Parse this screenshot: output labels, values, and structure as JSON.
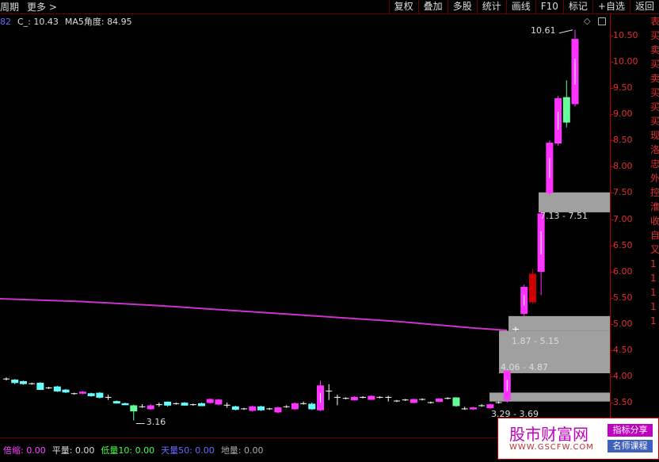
{
  "toolbar": {
    "left_items": [
      "周期",
      "更多 >"
    ],
    "right_buttons": [
      "复权",
      "叠加",
      "多股",
      "统计",
      "画线",
      "F10",
      "标记",
      "+自选",
      "返回"
    ]
  },
  "indicator": {
    "selected": "82",
    "close_label": "C_: 10.43",
    "ma5_angle_label": "MA5角度: 84.95"
  },
  "price_axis": {
    "ticks": [
      "10.50",
      "10.00",
      "9.50",
      "9.00",
      "8.50",
      "8.00",
      "7.50",
      "7.00",
      "6.50",
      "6.00",
      "5.50",
      "5.00",
      "4.50",
      "4.00",
      "3.50"
    ],
    "values": [
      10.5,
      10,
      9.5,
      9,
      8.5,
      8,
      7.5,
      7,
      6.5,
      6,
      5.5,
      5,
      4.5,
      4,
      3.5
    ]
  },
  "right_edge_chars": [
    "表",
    "买",
    "卖",
    "买",
    "卖",
    "买",
    "买",
    "买",
    "现",
    "洛",
    "忠",
    "外",
    "控",
    "淮",
    "收",
    "自",
    "又",
    "1",
    "1",
    "1",
    "1",
    "1"
  ],
  "annotations": {
    "high": "10.61",
    "low": "3.16",
    "zone1": "7.13 - 7.51",
    "zone2": "1.87 - 5.15",
    "zone3": "4.06 - 4.87",
    "zone4": "3.29 - 3.69"
  },
  "bottom_bar": {
    "item1": "倍缩: 0.00",
    "item2": "平量: 0.00",
    "item3": "低量10: 0.00",
    "item4": "天量50: 0.00",
    "item5": "地量: 0.00"
  },
  "watermark": {
    "main": "股市财富网",
    "url": "WWW.GSCFW.COM",
    "tag1": "指标分享",
    "tag2": "名师课程"
  },
  "colors": {
    "up": "#ff33ff",
    "down": "#66ffff",
    "green": "#66ff99",
    "red_body": "#cc0000",
    "ma_line": "#cc33cc",
    "zone": "#a0a0a0"
  },
  "chart_data": {
    "type": "candlestick",
    "ylim": [
      3.3,
      10.75
    ],
    "candles": [
      {
        "o": 3.95,
        "c": 3.95,
        "h": 3.98,
        "l": 3.92,
        "t": "flat"
      },
      {
        "o": 3.93,
        "c": 3.88,
        "h": 3.95,
        "l": 3.85,
        "t": "down"
      },
      {
        "o": 3.9,
        "c": 3.86,
        "h": 3.92,
        "l": 3.84,
        "t": "down"
      },
      {
        "o": 3.86,
        "c": 3.86,
        "h": 3.88,
        "l": 3.84,
        "t": "flat"
      },
      {
        "o": 3.87,
        "c": 3.75,
        "h": 3.89,
        "l": 3.74,
        "t": "down"
      },
      {
        "o": 3.78,
        "c": 3.78,
        "h": 3.8,
        "l": 3.76,
        "t": "flat"
      },
      {
        "o": 3.8,
        "c": 3.72,
        "h": 3.82,
        "l": 3.7,
        "t": "down"
      },
      {
        "o": 3.74,
        "c": 3.7,
        "h": 3.76,
        "l": 3.68,
        "t": "down"
      },
      {
        "o": 3.67,
        "c": 3.67,
        "h": 3.69,
        "l": 3.65,
        "t": "flat"
      },
      {
        "o": 3.7,
        "c": 3.68,
        "h": 3.72,
        "l": 3.66,
        "t": "up"
      },
      {
        "o": 3.67,
        "c": 3.63,
        "h": 3.69,
        "l": 3.61,
        "t": "down"
      },
      {
        "o": 3.68,
        "c": 3.6,
        "h": 3.7,
        "l": 3.58,
        "t": "down"
      },
      {
        "o": 3.6,
        "c": 3.6,
        "h": 3.65,
        "l": 3.55,
        "t": "flat"
      },
      {
        "o": 3.52,
        "c": 3.49,
        "h": 3.54,
        "l": 3.48,
        "t": "down"
      },
      {
        "o": 3.48,
        "c": 3.46,
        "h": 3.5,
        "l": 3.45,
        "t": "down"
      },
      {
        "o": 3.44,
        "c": 3.34,
        "h": 3.46,
        "l": 3.16,
        "t": "green"
      },
      {
        "o": 3.42,
        "c": 3.42,
        "h": 3.47,
        "l": 3.4,
        "t": "flat"
      },
      {
        "o": 3.38,
        "c": 3.44,
        "h": 3.47,
        "l": 3.36,
        "t": "up"
      },
      {
        "o": 3.46,
        "c": 3.46,
        "h": 3.5,
        "l": 3.42,
        "t": "flat"
      },
      {
        "o": 3.51,
        "c": 3.45,
        "h": 3.52,
        "l": 3.42,
        "t": "down"
      },
      {
        "o": 3.48,
        "c": 3.48,
        "h": 3.5,
        "l": 3.46,
        "t": "flat"
      },
      {
        "o": 3.49,
        "c": 3.45,
        "h": 3.51,
        "l": 3.44,
        "t": "down"
      },
      {
        "o": 3.46,
        "c": 3.46,
        "h": 3.48,
        "l": 3.44,
        "t": "flat"
      },
      {
        "o": 3.48,
        "c": 3.44,
        "h": 3.5,
        "l": 3.43,
        "t": "down"
      },
      {
        "o": 3.5,
        "c": 3.56,
        "h": 3.58,
        "l": 3.48,
        "t": "up"
      },
      {
        "o": 3.55,
        "c": 3.47,
        "h": 3.57,
        "l": 3.45,
        "t": "up"
      },
      {
        "o": 3.45,
        "c": 3.45,
        "h": 3.5,
        "l": 3.4,
        "t": "flat"
      },
      {
        "o": 3.42,
        "c": 3.37,
        "h": 3.44,
        "l": 3.35,
        "t": "down"
      },
      {
        "o": 3.38,
        "c": 3.38,
        "h": 3.4,
        "l": 3.36,
        "t": "flat"
      },
      {
        "o": 3.35,
        "c": 3.42,
        "h": 3.44,
        "l": 3.33,
        "t": "up"
      },
      {
        "o": 3.42,
        "c": 3.36,
        "h": 3.44,
        "l": 3.34,
        "t": "down"
      },
      {
        "o": 3.38,
        "c": 3.38,
        "h": 3.4,
        "l": 3.36,
        "t": "flat"
      },
      {
        "o": 3.32,
        "c": 3.4,
        "h": 3.42,
        "l": 3.3,
        "t": "up"
      },
      {
        "o": 3.42,
        "c": 3.42,
        "h": 3.45,
        "l": 3.4,
        "t": "flat"
      },
      {
        "o": 3.38,
        "c": 3.48,
        "h": 3.5,
        "l": 3.36,
        "t": "up"
      },
      {
        "o": 3.48,
        "c": 3.48,
        "h": 3.52,
        "l": 3.46,
        "t": "flat"
      },
      {
        "o": 3.47,
        "c": 3.38,
        "h": 3.5,
        "l": 3.36,
        "t": "down"
      },
      {
        "o": 3.36,
        "c": 3.82,
        "h": 3.92,
        "l": 3.34,
        "t": "up"
      },
      {
        "o": 3.72,
        "c": 3.72,
        "h": 3.85,
        "l": 3.55,
        "t": "flat"
      },
      {
        "o": 3.6,
        "c": 3.6,
        "h": 3.65,
        "l": 3.45,
        "t": "flat"
      },
      {
        "o": 3.58,
        "c": 3.58,
        "h": 3.6,
        "l": 3.56,
        "t": "flat"
      },
      {
        "o": 3.55,
        "c": 3.6,
        "h": 3.62,
        "l": 3.54,
        "t": "up"
      },
      {
        "o": 3.6,
        "c": 3.6,
        "h": 3.62,
        "l": 3.58,
        "t": "flat"
      },
      {
        "o": 3.56,
        "c": 3.62,
        "h": 3.64,
        "l": 3.55,
        "t": "up"
      },
      {
        "o": 3.6,
        "c": 3.6,
        "h": 3.62,
        "l": 3.58,
        "t": "flat"
      },
      {
        "o": 3.6,
        "c": 3.6,
        "h": 3.63,
        "l": 3.52,
        "t": "flat"
      },
      {
        "o": 3.53,
        "c": 3.53,
        "h": 3.55,
        "l": 3.51,
        "t": "flat"
      },
      {
        "o": 3.55,
        "c": 3.55,
        "h": 3.57,
        "l": 3.53,
        "t": "flat"
      },
      {
        "o": 3.5,
        "c": 3.56,
        "h": 3.57,
        "l": 3.49,
        "t": "up"
      },
      {
        "o": 3.56,
        "c": 3.56,
        "h": 3.58,
        "l": 3.54,
        "t": "flat"
      },
      {
        "o": 3.5,
        "c": 3.5,
        "h": 3.52,
        "l": 3.48,
        "t": "flat"
      },
      {
        "o": 3.52,
        "c": 3.57,
        "h": 3.58,
        "l": 3.51,
        "t": "up"
      },
      {
        "o": 3.58,
        "c": 3.58,
        "h": 3.6,
        "l": 3.56,
        "t": "flat"
      },
      {
        "o": 3.59,
        "c": 3.44,
        "h": 3.6,
        "l": 3.42,
        "t": "green"
      },
      {
        "o": 3.38,
        "c": 3.38,
        "h": 3.42,
        "l": 3.36,
        "t": "flat"
      },
      {
        "o": 3.38,
        "c": 3.4,
        "h": 3.42,
        "l": 3.36,
        "t": "up"
      },
      {
        "o": 3.44,
        "c": 3.44,
        "h": 3.47,
        "l": 3.42,
        "t": "flat"
      },
      {
        "o": 3.4,
        "c": 3.46,
        "h": 3.48,
        "l": 3.38,
        "t": "up"
      },
      {
        "o": 3.5,
        "c": 3.5,
        "h": 3.52,
        "l": 3.48,
        "t": "flat"
      },
      {
        "o": 3.55,
        "c": 4.1,
        "h": 4.1,
        "l": 3.5,
        "t": "up"
      },
      {
        "o": 4.9,
        "c": 4.9,
        "h": 4.95,
        "l": 4.86,
        "t": "flat"
      },
      {
        "o": 5.2,
        "c": 5.7,
        "h": 5.75,
        "l": 5.15,
        "t": "up"
      },
      {
        "o": 5.42,
        "c": 5.95,
        "h": 6.05,
        "l": 5.38,
        "t": "red"
      },
      {
        "o": 6.0,
        "c": 7.1,
        "h": 7.15,
        "l": 5.55,
        "t": "up"
      },
      {
        "o": 7.5,
        "c": 8.45,
        "h": 8.5,
        "l": 7.45,
        "t": "up"
      },
      {
        "o": 8.45,
        "c": 9.3,
        "h": 9.35,
        "l": 8.4,
        "t": "up"
      },
      {
        "o": 9.32,
        "c": 8.85,
        "h": 9.65,
        "l": 8.75,
        "t": "green"
      },
      {
        "o": 9.2,
        "c": 10.43,
        "h": 10.61,
        "l": 9.15,
        "t": "up"
      }
    ],
    "ma_line": [
      [
        0,
        5.48
      ],
      [
        100,
        5.43
      ],
      [
        200,
        5.35
      ],
      [
        300,
        5.25
      ],
      [
        400,
        5.15
      ],
      [
        500,
        5.05
      ],
      [
        600,
        4.92
      ],
      [
        640,
        4.88
      ]
    ],
    "ma_line2": [
      [
        660,
        4.9
      ],
      [
        690,
        5.0
      ],
      [
        725,
        5.12
      ]
    ],
    "zones": [
      {
        "x0": 680,
        "y_low": 7.13,
        "y_high": 7.51
      },
      {
        "x0": 642,
        "y_low": 4.87,
        "y_high": 5.15
      },
      {
        "x0": 630,
        "y_low": 4.06,
        "y_high": 4.87
      },
      {
        "x0": 618,
        "y_low": 3.52,
        "y_high": 3.69
      }
    ]
  }
}
